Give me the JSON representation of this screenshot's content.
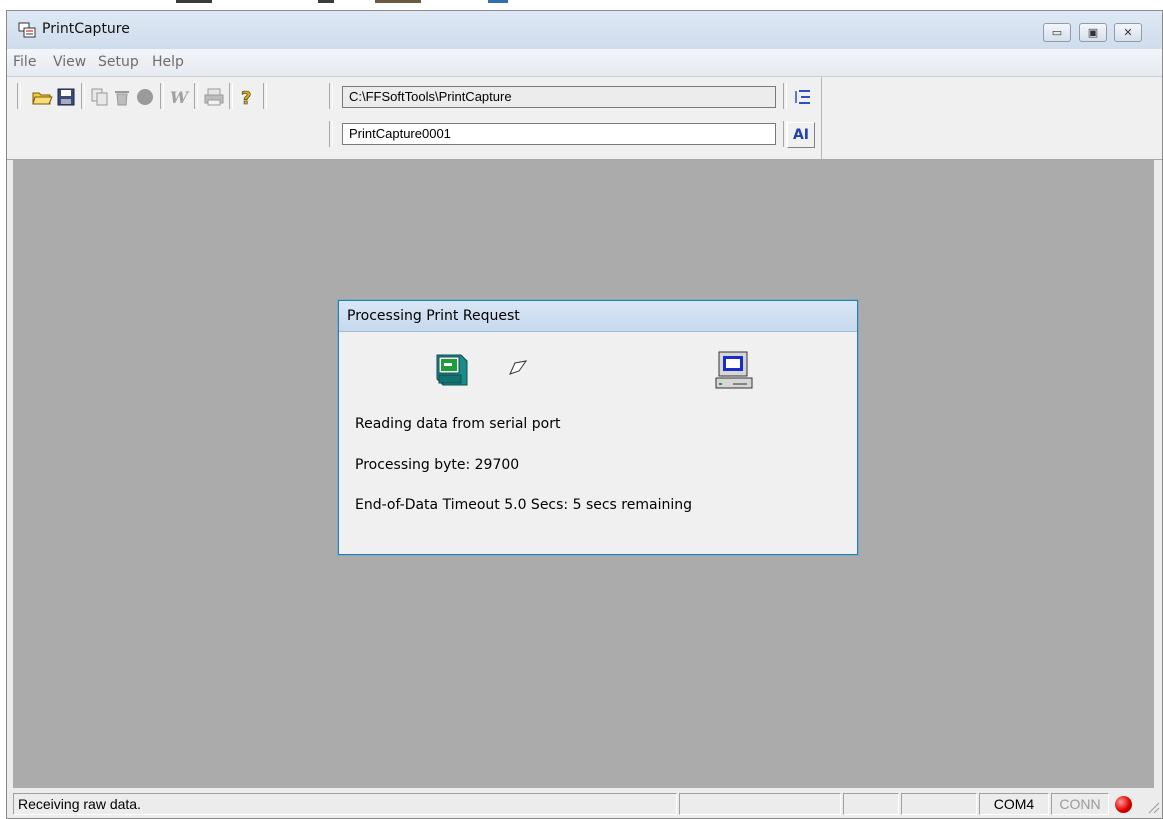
{
  "window": {
    "title": "PrintCapture"
  },
  "menu": [
    "File",
    "View",
    "Setup",
    "Help"
  ],
  "toolbar": {
    "buttons": [
      {
        "name": "open-folder-icon",
        "enabled": true
      },
      {
        "name": "save-icon",
        "enabled": true
      },
      {
        "name": "copy-icon",
        "enabled": false
      },
      {
        "name": "trash-icon",
        "enabled": false
      },
      {
        "name": "record-icon",
        "enabled": false
      },
      {
        "name": "word-icon",
        "enabled": false
      },
      {
        "name": "print-icon",
        "enabled": false
      },
      {
        "name": "help-icon",
        "enabled": true
      }
    ],
    "path_value": "C:\\FFSoftTools\\PrintCapture",
    "filename_value": "PrintCapture0001",
    "filename_button_label": "AI"
  },
  "dialog": {
    "title": "Processing Print Request",
    "status_text": "Reading data from serial port",
    "processing_text": "Processing byte:  29700",
    "timeout_text": "End-of-Data Timeout 5.0 Secs: 5 secs remaining"
  },
  "statusbar": {
    "message": "Receiving raw data.",
    "port": "COM4",
    "conn": "CONN",
    "indicator_color": "#e00000"
  },
  "colors": {
    "workspace": "#ababab",
    "dialog_border": "#2a7fa7"
  }
}
